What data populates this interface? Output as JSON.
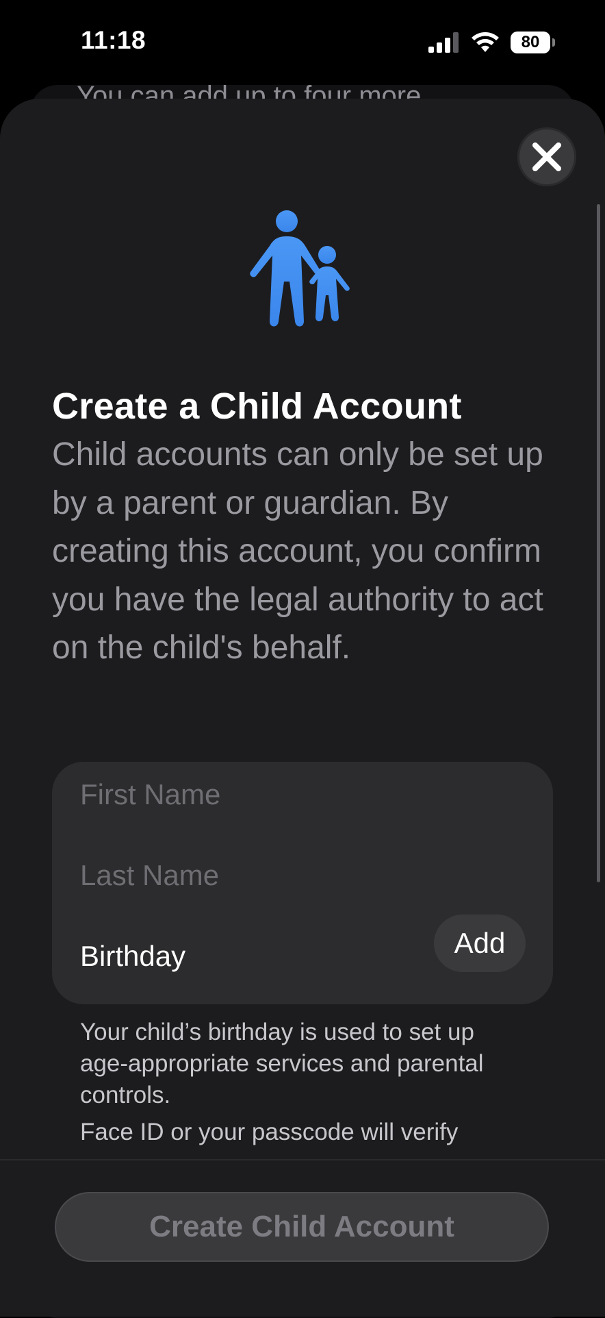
{
  "status_bar": {
    "time": "11:18",
    "battery": "80"
  },
  "background_sheet": {
    "peek_text": "You can add up to four more"
  },
  "sheet": {
    "title": "Create a Child Account",
    "description": "Child accounts can only be set up by a parent or guardian. By creating this account, you confirm you have the legal authority to act on the child's behalf.",
    "form": {
      "first_name_placeholder": "First Name",
      "last_name_placeholder": "Last Name",
      "birthday_label": "Birthday",
      "add_label": "Add"
    },
    "footnote": "Your child’s birthday is used to set up age-appropriate services and parental controls.",
    "footnote_2": "Face ID or your passcode will verify",
    "primary_button": "Create Child Account"
  },
  "icons": {
    "family": "parent-child-icon",
    "close": "close-icon"
  },
  "colors": {
    "accent": "#3f8ef0",
    "sheet_bg": "#1c1c1e",
    "card_bg": "#2c2c2e"
  }
}
